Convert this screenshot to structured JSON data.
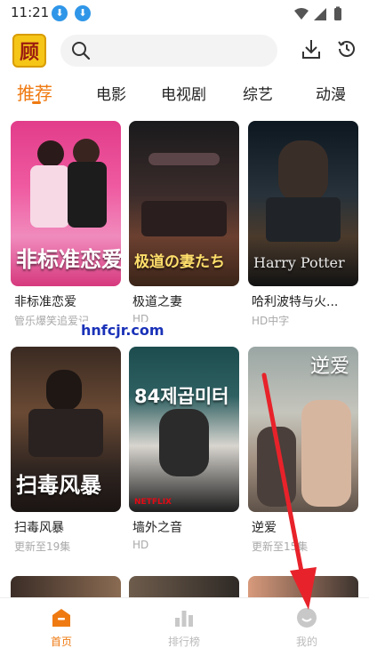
{
  "status_bar": {
    "time": "11:21"
  },
  "header": {
    "logo_char": "顾",
    "search": {
      "placeholder": ""
    }
  },
  "tabs": [
    {
      "label": "推荐",
      "active": true
    },
    {
      "label": "电影"
    },
    {
      "label": "电视剧"
    },
    {
      "label": "综艺"
    },
    {
      "label": "动漫"
    }
  ],
  "grid": [
    {
      "title": "非标准恋爱",
      "subtitle": "管乐爆笑追爱记",
      "poster_text": "非标准恋爱"
    },
    {
      "title": "极道之妻",
      "subtitle": "HD",
      "poster_text": "极道の妻たち"
    },
    {
      "title": "哈利波特与火...",
      "subtitle": "HD中字",
      "poster_text": "Harry Potter"
    },
    {
      "title": "扫毒风暴",
      "subtitle": "更新至19集",
      "poster_text": "扫毒风暴"
    },
    {
      "title": "墙外之音",
      "subtitle": "HD",
      "poster_text": "84제곱미터"
    },
    {
      "title": "逆爱",
      "subtitle": "更新至15集",
      "poster_text": "逆爱"
    }
  ],
  "watermark": "hnfcjr.com",
  "bottom_nav": [
    {
      "label": "首页",
      "active": true
    },
    {
      "label": "排行榜"
    },
    {
      "label": "我的"
    }
  ],
  "colors": {
    "accent": "#ef7a12",
    "arrow": "#e8222a",
    "inactive": "#bbbbbb"
  }
}
